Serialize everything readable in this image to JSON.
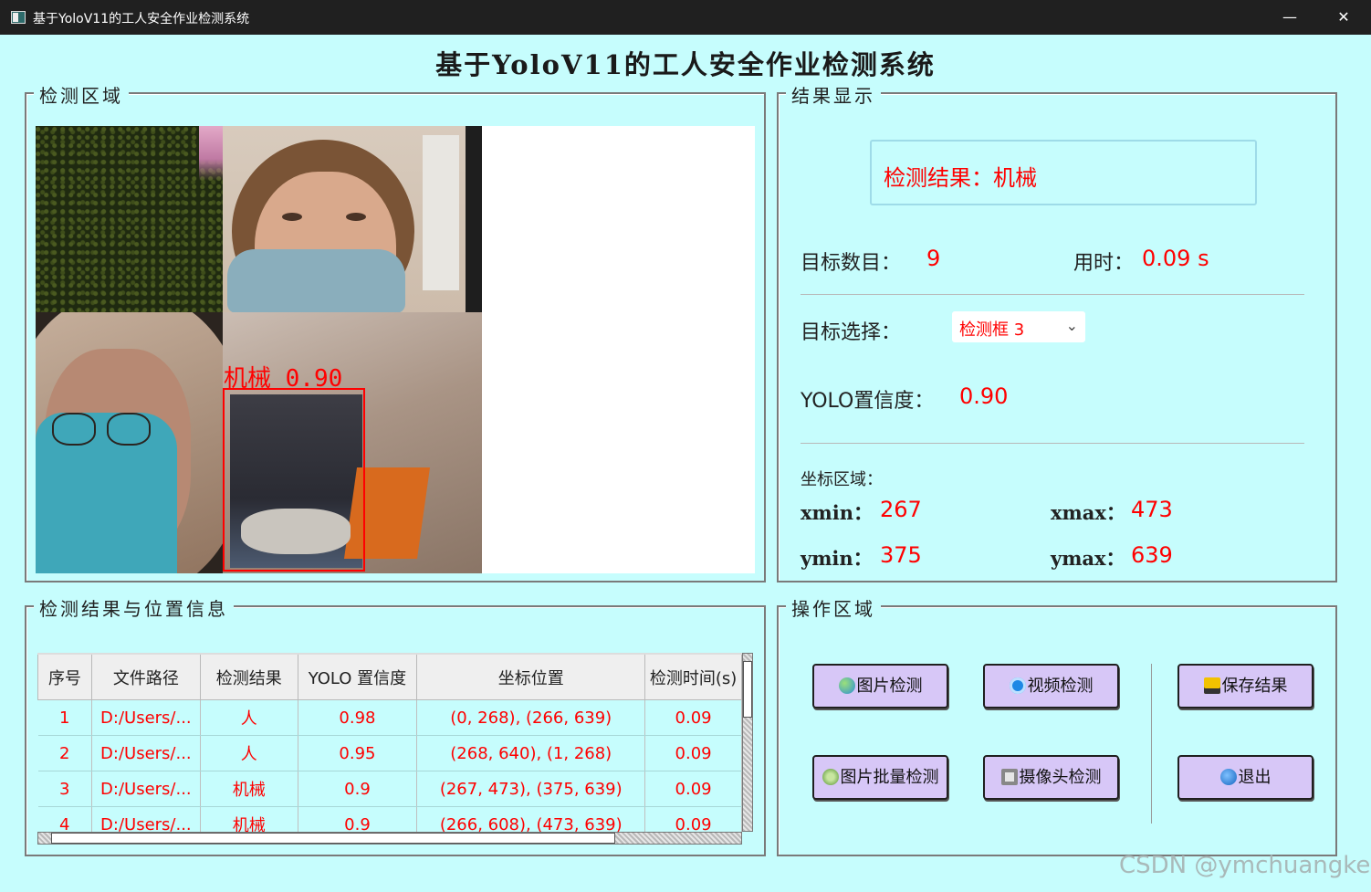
{
  "window": {
    "title": "基于YoloV11的工人安全作业检测系统",
    "min": "—",
    "max": "☐",
    "close": "✕"
  },
  "app_title": "基于YoloV11的工人安全作业检测系统",
  "detect_area": {
    "label": "检测区域",
    "box_label": "机械 0.90"
  },
  "result_area": {
    "label": "结果显示",
    "detect_result": "检测结果：机械",
    "target_count_label": "目标数目：",
    "target_count": "9",
    "time_label": "用时：",
    "time": "0.09 s",
    "target_select_label": "目标选择：",
    "target_select": "检测框 3",
    "conf_label": "YOLO置信度：",
    "conf": "0.90",
    "coord_label": "坐标区域：",
    "xmin_label": "xmin：",
    "xmin": "267",
    "xmax_label": "xmax：",
    "xmax": "473",
    "ymin_label": "ymin：",
    "ymin": "375",
    "ymax_label": "ymax：",
    "ymax": "639"
  },
  "table_area": {
    "label": "检测结果与位置信息",
    "headers": [
      "序号",
      "文件路径",
      "检测结果",
      "YOLO 置信度",
      "坐标位置",
      "检测时间(s)"
    ],
    "rows": [
      [
        "1",
        "D:/Users/...",
        "人",
        "0.98",
        "(0, 268), (266, 639)",
        "0.09"
      ],
      [
        "2",
        "D:/Users/...",
        "人",
        "0.95",
        "(268, 640), (1, 268)",
        "0.09"
      ],
      [
        "3",
        "D:/Users/...",
        "机械",
        "0.9",
        "(267, 473), (375, 639)",
        "0.09"
      ],
      [
        "4",
        "D:/Users/...",
        "机械",
        "0.9",
        "(266, 608), (473, 639)",
        "0.09"
      ]
    ]
  },
  "ops_area": {
    "label": "操作区域",
    "image_detect": "图片检测",
    "video_detect": "视频检测",
    "save_result": "保存结果",
    "batch_detect": "图片批量检测",
    "camera_detect": "摄像头检测",
    "exit": "退出"
  },
  "colors": {
    "background": "#c6fdfd",
    "accent_red": "#ff0000",
    "button": "#d7c7f7"
  },
  "watermark": "CSDN @ymchuangke"
}
